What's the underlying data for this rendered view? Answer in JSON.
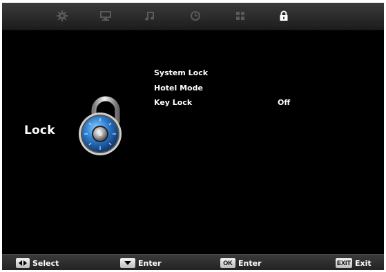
{
  "tabs": [
    {
      "icon": "gear-icon"
    },
    {
      "icon": "monitor-icon"
    },
    {
      "icon": "music-note-icon"
    },
    {
      "icon": "clock-icon"
    },
    {
      "icon": "grid-icon"
    },
    {
      "icon": "lock-icon",
      "selected": true
    }
  ],
  "page": {
    "title": "Lock"
  },
  "menu": {
    "items": [
      {
        "label": "System Lock",
        "value": ""
      },
      {
        "label": "Hotel Mode",
        "value": ""
      },
      {
        "label": "Key Lock",
        "value": "Off"
      }
    ]
  },
  "footer": {
    "select": {
      "key": "left-right-arrows-icon",
      "label": "Select"
    },
    "enter_down": {
      "key": "down-arrow-icon",
      "label": "Enter"
    },
    "enter_ok": {
      "key": "OK",
      "label": "Enter"
    },
    "exit": {
      "key": "EXIT",
      "label": "Exit"
    }
  },
  "colors": {
    "background": "#000000",
    "text": "#ffffff",
    "bar": "#2f2f2f",
    "active_icon": "#ffffff",
    "inactive_icon": "#5a5a5a",
    "padlock_blue": "#2f7fd0"
  }
}
